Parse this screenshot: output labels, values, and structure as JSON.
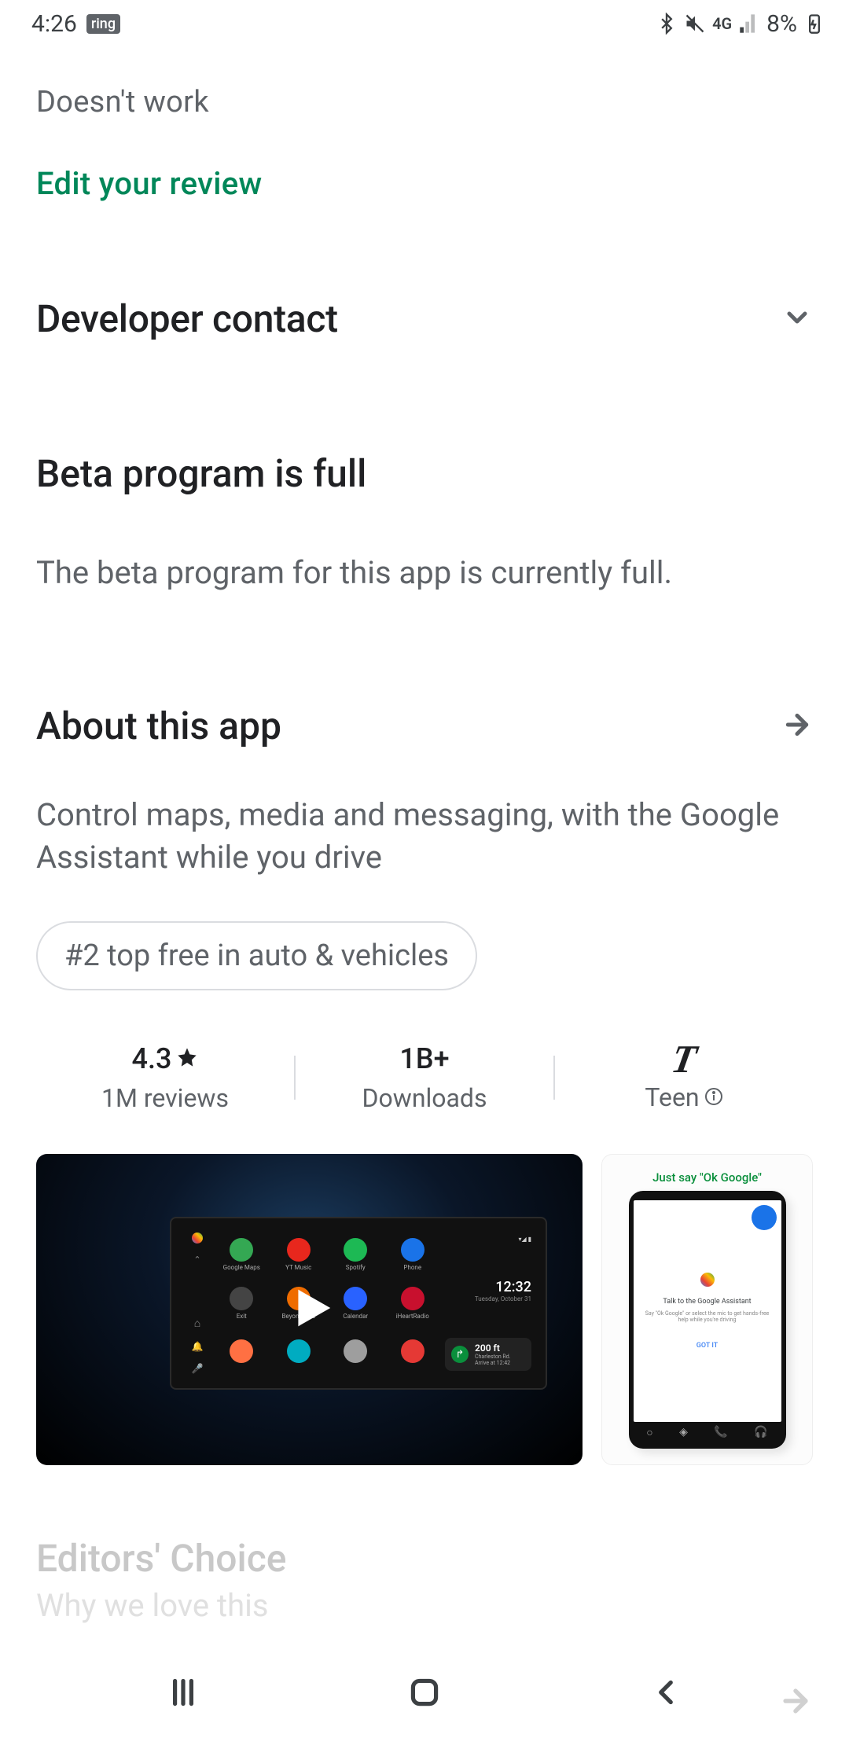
{
  "status_bar": {
    "time": "4:26",
    "app_badge": "ring",
    "network": "4G",
    "battery_pct": "8%"
  },
  "review": {
    "text": "Doesn't work",
    "edit_label": "Edit your review"
  },
  "developer_contact": {
    "heading": "Developer contact"
  },
  "beta": {
    "heading": "Beta program is full",
    "body": "The beta program for this app is currently full."
  },
  "about": {
    "heading": "About this app",
    "body": "Control maps, media and messaging, with the Google Assistant while you drive",
    "chip": "#2 top free in auto & vehicles"
  },
  "stats": {
    "rating": "4.3",
    "reviews": "1M reviews",
    "downloads_count": "1B+",
    "downloads_label": "Downloads",
    "content_rating": "Teen"
  },
  "video": {
    "car_time": "12:32",
    "car_date": "Tuesday, October 31",
    "nav_distance": "200 ft",
    "nav_dest": "Charleston Rd.",
    "nav_arrive": "Arrive at 12:42",
    "apps": [
      {
        "label": "Google Maps",
        "color": "#34a853"
      },
      {
        "label": "YT Music",
        "color": "#e8271d"
      },
      {
        "label": "Spotify",
        "color": "#1db954"
      },
      {
        "label": "Phone",
        "color": "#1a73e8"
      },
      {
        "label": "Exit",
        "color": "#444"
      },
      {
        "label": "Beyond Pod",
        "color": "#ef6c00"
      },
      {
        "label": "Calendar",
        "color": "#2962ff"
      },
      {
        "label": "iHeartRadio",
        "color": "#c8102e"
      },
      {
        "label": "",
        "color": "#ff7043"
      },
      {
        "label": "",
        "color": "#00acc1"
      },
      {
        "label": "",
        "color": "#9e9e9e"
      },
      {
        "label": "",
        "color": "#e53935"
      }
    ]
  },
  "screenshot2": {
    "headline": "Just say \"Ok Google\"",
    "assist_title": "Talk to the Google Assistant",
    "assist_sub": "Say \"Ok Google\" or select the mic to get hands-free help while you're driving",
    "gotit": "GOT IT"
  },
  "editors": {
    "heading": "Editors' Choice",
    "sub": "Why we love this"
  }
}
